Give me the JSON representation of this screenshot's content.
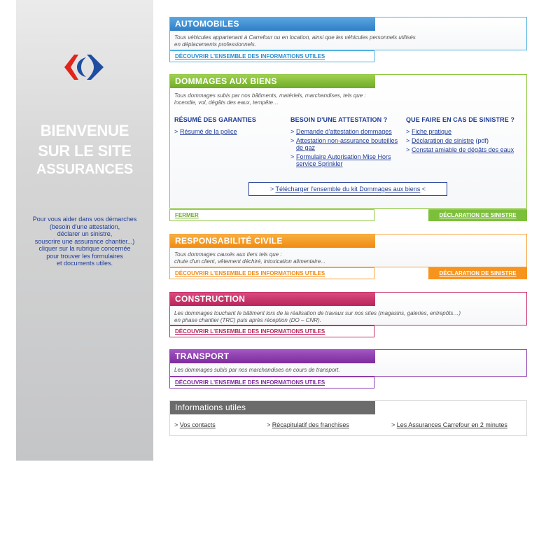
{
  "sidebar": {
    "welcome_line1": "BIENVENUE",
    "welcome_line2": "SUR LE SITE",
    "welcome_line3": "ASSURANCES",
    "help_text": "Pour vous aider dans vos démarches\n(besoin d'une attestation,\ndéclarer un sinistre,\nsouscrire une assurance chantier...)\ncliquer sur la rubrique concernée\npour trouver les formulaires\net documents utiles.",
    "logo_icon": "carrefour-logo"
  },
  "colors": {
    "automobiles": "#3a8ed2",
    "dommages": "#8dc63f",
    "responsabilite": "#f7941d",
    "construction": "#c9306a",
    "transport": "#8f3cae",
    "infos": "#6b6b6b",
    "link_blue": "#1f3c96"
  },
  "automobiles": {
    "title": "AUTOMOBILES",
    "desc": "Tous véhicules appartenant à Carrefour ou en location, ainsi que les véhicules personnels utilisés\nen déplacements professionnels.",
    "link": "DÉCOUVRIR L'ENSEMBLE DES INFORMATIONS UTILES"
  },
  "dommages": {
    "title": "DOMMAGES AUX BIENS",
    "desc": "Tous dommages subis par nos bâtiments, matériels, marchandises, tels que :\nincendie, vol, dégâts des eaux, tempête…",
    "col1": {
      "title": "RÉSUMÉ DES GARANTIES",
      "items": [
        "Résumé de la police"
      ]
    },
    "col2": {
      "title": "BESOIN D'UNE ATTESTATION ?",
      "items": [
        "Demande d'attestation dommages",
        "Attestation non-assurance bouteilles de gaz",
        "Formulaire Autorisation Mise Hors service Sprinkler"
      ]
    },
    "col3": {
      "title": "QUE FAIRE EN CAS DE SINISTRE ?",
      "items": [
        "Fiche pratique",
        "Déclaration de sinistre",
        "Constat amiable de dégâts des eaux"
      ],
      "item2_suffix": " (pdf)"
    },
    "kit_prefix": "> ",
    "kit_link": "Télécharger l'ensemble du kit Dommages aux biens",
    "kit_suffix": " <",
    "close": "FERMER",
    "declaration": "DÉCLARATION DE SINISTRE"
  },
  "responsabilite": {
    "title": "RESPONSABILITÉ CIVILE",
    "desc": "Tous dommages causés aux tiers tels que :\nchute d'un client, vêtement déchiré, intoxication alimentaire...",
    "link": "DÉCOUVRIR L'ENSEMBLE DES INFORMATIONS UTILES",
    "declaration": "DÉCLARATION DE SINISTRE"
  },
  "construction": {
    "title": "CONSTRUCTION",
    "desc": "Les dommages touchant le bâtiment lors de la réalisation de travaux sur nos sites (magasins, galeries, entrepôts…)\nen phase chantier (TRC) puis après réception (DO – CNR).",
    "link": "DÉCOUVRIR L'ENSEMBLE DES INFORMATIONS UTILES"
  },
  "transport": {
    "title": "TRANSPORT",
    "desc": "Les dommages subis par nos marchandises en cours de transport.",
    "link": "DÉCOUVRIR L'ENSEMBLE DES INFORMATIONS UTILES"
  },
  "infos": {
    "title": "Informations utiles",
    "links": [
      "Vos contacts",
      "Récapitulatif des franchises",
      "Les Assurances Carrefour en 2 minutes"
    ]
  }
}
